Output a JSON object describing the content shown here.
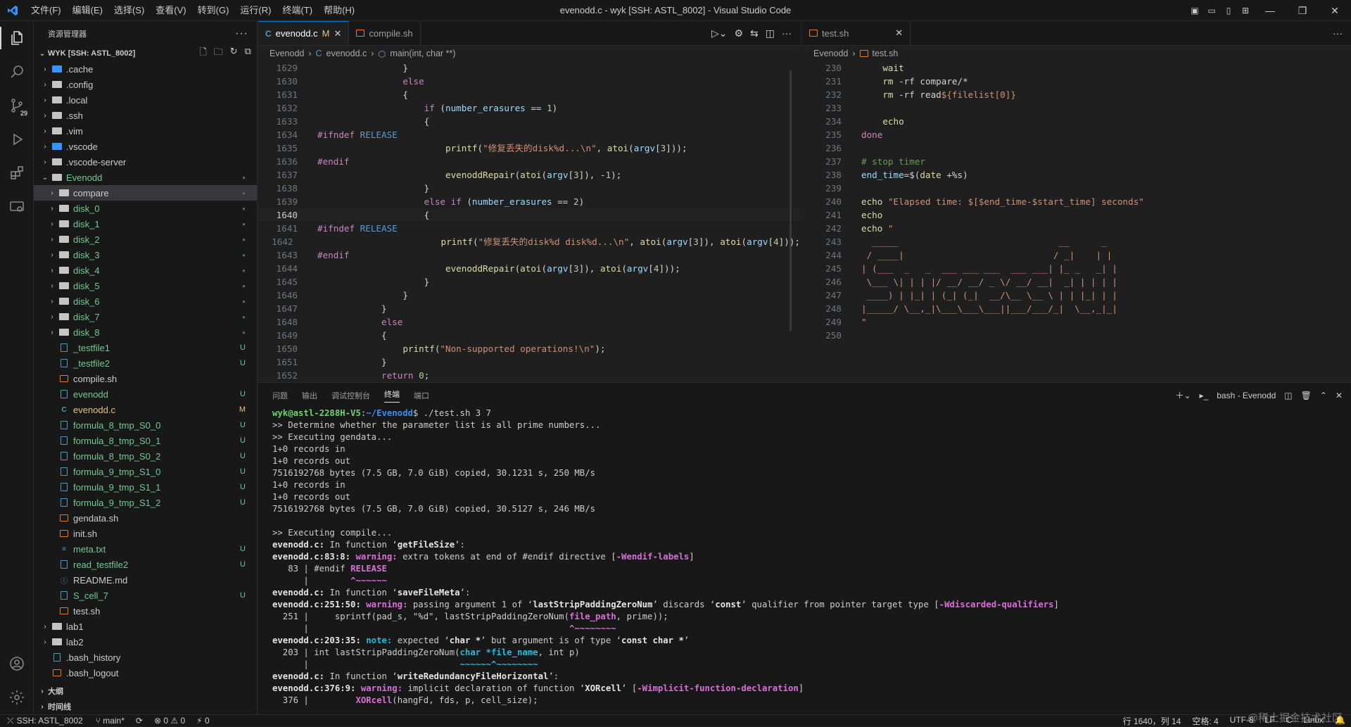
{
  "window": {
    "title": "evenodd.c - wyk [SSH: ASTL_8002] - Visual Studio Code",
    "menu": [
      "文件(F)",
      "编辑(E)",
      "选择(S)",
      "查看(V)",
      "转到(G)",
      "运行(R)",
      "终端(T)",
      "帮助(H)"
    ]
  },
  "activity": {
    "scm_badge": "29"
  },
  "sidebar": {
    "title": "资源管理器",
    "workspace": "WYK [SSH: ASTL_8002]",
    "tree": [
      {
        "label": ".cache",
        "kind": "folder-vscode",
        "depth": 0,
        "expanded": false,
        "status": ""
      },
      {
        "label": ".config",
        "kind": "folder",
        "depth": 0,
        "expanded": false,
        "status": ""
      },
      {
        "label": ".local",
        "kind": "folder",
        "depth": 0,
        "expanded": false,
        "status": ""
      },
      {
        "label": ".ssh",
        "kind": "folder",
        "depth": 0,
        "expanded": false,
        "status": ""
      },
      {
        "label": ".vim",
        "kind": "folder",
        "depth": 0,
        "expanded": false,
        "status": ""
      },
      {
        "label": ".vscode",
        "kind": "folder-vscode",
        "depth": 0,
        "expanded": false,
        "status": ""
      },
      {
        "label": ".vscode-server",
        "kind": "folder",
        "depth": 0,
        "expanded": false,
        "status": ""
      },
      {
        "label": "Evenodd",
        "kind": "folder",
        "depth": 0,
        "expanded": true,
        "status": "dot-green"
      },
      {
        "label": "compare",
        "kind": "folder",
        "depth": 1,
        "expanded": false,
        "status": "dot-grey",
        "selected": true
      },
      {
        "label": "disk_0",
        "kind": "folder",
        "depth": 1,
        "expanded": false,
        "status": "dot-green"
      },
      {
        "label": "disk_1",
        "kind": "folder",
        "depth": 1,
        "expanded": false,
        "status": "dot-green"
      },
      {
        "label": "disk_2",
        "kind": "folder",
        "depth": 1,
        "expanded": false,
        "status": "dot-green"
      },
      {
        "label": "disk_3",
        "kind": "folder",
        "depth": 1,
        "expanded": false,
        "status": "dot-green"
      },
      {
        "label": "disk_4",
        "kind": "folder",
        "depth": 1,
        "expanded": false,
        "status": "dot-green"
      },
      {
        "label": "disk_5",
        "kind": "folder",
        "depth": 1,
        "expanded": false,
        "status": "dot-green"
      },
      {
        "label": "disk_6",
        "kind": "folder",
        "depth": 1,
        "expanded": false,
        "status": "dot-green"
      },
      {
        "label": "disk_7",
        "kind": "folder",
        "depth": 1,
        "expanded": false,
        "status": "dot-green"
      },
      {
        "label": "disk_8",
        "kind": "folder",
        "depth": 1,
        "expanded": false,
        "status": "dot-green"
      },
      {
        "label": "_testfile1",
        "kind": "file",
        "depth": 1,
        "status": "U"
      },
      {
        "label": "_testfile2",
        "kind": "file",
        "depth": 1,
        "status": "U"
      },
      {
        "label": "compile.sh",
        "kind": "shell",
        "depth": 1,
        "status": ""
      },
      {
        "label": "evenodd",
        "kind": "file",
        "depth": 1,
        "status": "U"
      },
      {
        "label": "evenodd.c",
        "kind": "c",
        "depth": 1,
        "status": "M"
      },
      {
        "label": "formula_8_tmp_S0_0",
        "kind": "file",
        "depth": 1,
        "status": "U"
      },
      {
        "label": "formula_8_tmp_S0_1",
        "kind": "file",
        "depth": 1,
        "status": "U"
      },
      {
        "label": "formula_8_tmp_S0_2",
        "kind": "file",
        "depth": 1,
        "status": "U"
      },
      {
        "label": "formula_9_tmp_S1_0",
        "kind": "file",
        "depth": 1,
        "status": "U"
      },
      {
        "label": "formula_9_tmp_S1_1",
        "kind": "file",
        "depth": 1,
        "status": "U"
      },
      {
        "label": "formula_9_tmp_S1_2",
        "kind": "file",
        "depth": 1,
        "status": "U"
      },
      {
        "label": "gendata.sh",
        "kind": "shell",
        "depth": 1,
        "status": ""
      },
      {
        "label": "init.sh",
        "kind": "shell",
        "depth": 1,
        "status": ""
      },
      {
        "label": "meta.txt",
        "kind": "txt",
        "depth": 1,
        "status": "U"
      },
      {
        "label": "read_testfile2",
        "kind": "file",
        "depth": 1,
        "status": "U"
      },
      {
        "label": "README.md",
        "kind": "info",
        "depth": 1,
        "status": ""
      },
      {
        "label": "S_cell_7",
        "kind": "file",
        "depth": 1,
        "status": "U"
      },
      {
        "label": "test.sh",
        "kind": "shell",
        "depth": 1,
        "status": ""
      },
      {
        "label": "lab1",
        "kind": "folder",
        "depth": 0,
        "expanded": false,
        "status": ""
      },
      {
        "label": "lab2",
        "kind": "folder",
        "depth": 0,
        "expanded": false,
        "status": ""
      },
      {
        "label": ".bash_history",
        "kind": "file",
        "depth": 0,
        "status": ""
      },
      {
        "label": ".bash_logout",
        "kind": "shell",
        "depth": 0,
        "status": ""
      }
    ],
    "outline_label": "大纲",
    "timeline_label": "时间线"
  },
  "editor1": {
    "tabs": [
      {
        "label": "evenodd.c",
        "modified": "M",
        "active": true,
        "icon": "C"
      },
      {
        "label": "compile.sh",
        "modified": "",
        "active": false,
        "icon": "shell"
      }
    ],
    "breadcrumb": [
      "Evenodd",
      "evenodd.c",
      "main(int, char **)"
    ],
    "current_line": "1640",
    "lines": [
      {
        "no": "1629",
        "html": "                }"
      },
      {
        "no": "1630",
        "html": "                <span class=\"kw\">else</span>"
      },
      {
        "no": "1631",
        "html": "                {"
      },
      {
        "no": "1632",
        "html": "                    <span class=\"kw\">if</span> (<span class=\"var\">number_erasures</span> == <span class=\"num\">1</span>)"
      },
      {
        "no": "1633",
        "html": "                    {"
      },
      {
        "no": "1634",
        "html": "<span class=\"pp\">#ifndef</span> <span class=\"mac\">RELEASE</span>"
      },
      {
        "no": "1635",
        "html": "                        <span class=\"fn\">printf</span>(<span class=\"str\">\"修复丢失的disk%d...\\n\"</span>, <span class=\"fn\">atoi</span>(<span class=\"var\">argv</span>[<span class=\"num\">3</span>]));"
      },
      {
        "no": "1636",
        "html": "<span class=\"pp\">#endif</span>"
      },
      {
        "no": "1637",
        "html": "                        <span class=\"fn\">evenoddRepair</span>(<span class=\"fn\">atoi</span>(<span class=\"var\">argv</span>[<span class=\"num\">3</span>]), -<span class=\"num\">1</span>);"
      },
      {
        "no": "1638",
        "html": "                    }"
      },
      {
        "no": "1639",
        "html": "                    <span class=\"kw\">else if</span> (<span class=\"var\">number_erasures</span> == <span class=\"num\">2</span>)"
      },
      {
        "no": "1640",
        "html": "                    {"
      },
      {
        "no": "1641",
        "html": "<span class=\"pp\">#ifndef</span> <span class=\"mac\">RELEASE</span>"
      },
      {
        "no": "1642",
        "html": "                        <span class=\"fn\">printf</span>(<span class=\"str\">\"修复丢失的disk%d disk%d...\\n\"</span>, <span class=\"fn\">atoi</span>(<span class=\"var\">argv</span>[<span class=\"num\">3</span>]), <span class=\"fn\">atoi</span>(<span class=\"var\">argv</span>[<span class=\"num\">4</span>]));"
      },
      {
        "no": "1643",
        "html": "<span class=\"pp\">#endif</span>"
      },
      {
        "no": "1644",
        "html": "                        <span class=\"fn\">evenoddRepair</span>(<span class=\"fn\">atoi</span>(<span class=\"var\">argv</span>[<span class=\"num\">3</span>]), <span class=\"fn\">atoi</span>(<span class=\"var\">argv</span>[<span class=\"num\">4</span>]));"
      },
      {
        "no": "1645",
        "html": "                    }"
      },
      {
        "no": "1646",
        "html": "                }"
      },
      {
        "no": "1647",
        "html": "            }"
      },
      {
        "no": "1648",
        "html": "            <span class=\"kw\">else</span>"
      },
      {
        "no": "1649",
        "html": "            {"
      },
      {
        "no": "1650",
        "html": "                <span class=\"fn\">printf</span>(<span class=\"str\">\"Non-supported operations!\\n\"</span>);"
      },
      {
        "no": "1651",
        "html": "            }"
      },
      {
        "no": "1652",
        "html": "            <span class=\"kw\">return</span> <span class=\"num\">0</span>;"
      }
    ]
  },
  "editor2": {
    "tabs": [
      {
        "label": "test.sh",
        "active": false,
        "icon": "shell"
      }
    ],
    "breadcrumb": [
      "Evenodd",
      "test.sh"
    ],
    "lines": [
      {
        "no": "230",
        "html": "    <span class=\"fn\">wait</span>"
      },
      {
        "no": "231",
        "html": "    <span class=\"fn\">rm</span> -rf compare/*"
      },
      {
        "no": "232",
        "html": "    <span class=\"fn\">rm</span> -rf read<span class=\"str\">${filelist[0]}</span>"
      },
      {
        "no": "233",
        "html": ""
      },
      {
        "no": "234",
        "html": "    <span class=\"fn\">echo</span>"
      },
      {
        "no": "235",
        "html": "<span class=\"kw\">done</span>"
      },
      {
        "no": "236",
        "html": ""
      },
      {
        "no": "237",
        "html": "<span class=\"cm\"># stop timer</span>"
      },
      {
        "no": "238",
        "html": "<span class=\"var\">end_time</span>=$(<span class=\"fn\">date</span> +%s)"
      },
      {
        "no": "239",
        "html": ""
      },
      {
        "no": "240",
        "html": "<span class=\"fn\">echo</span> <span class=\"str\">\"Elapsed time: $[$end_time-$start_time] seconds\"</span>"
      },
      {
        "no": "241",
        "html": "<span class=\"fn\">echo</span>"
      },
      {
        "no": "242",
        "html": "<span class=\"fn\">echo</span> <span class=\"str\">\"</span>"
      },
      {
        "no": "243",
        "html": "<span class=\"str\">  _____                              __      _ </span>"
      },
      {
        "no": "244",
        "html": "<span class=\"str\"> / ____|                            / _|    | |</span>"
      },
      {
        "no": "245",
        "html": "<span class=\"str\">| (___  _   _  ___ ___ ___  ___ ___| |_ _   _| |</span>"
      },
      {
        "no": "246",
        "html": "<span class=\"str\"> \\___ \\| | | |/ __/ __/ _ \\/ __/ __|  _| | | | |</span>"
      },
      {
        "no": "247",
        "html": "<span class=\"str\"> ____) | |_| | (_| (_|  __/\\__ \\__ \\ | | |_| | |</span>"
      },
      {
        "no": "248",
        "html": "<span class=\"str\">|_____/ \\__,_|\\___\\___\\___||___/___/_|  \\__,_|_|</span>"
      },
      {
        "no": "249",
        "html": "<span class=\"str\">\"</span>"
      },
      {
        "no": "250",
        "html": ""
      }
    ]
  },
  "panel": {
    "tabs": [
      "问题",
      "输出",
      "调试控制台",
      "终端",
      "端口"
    ],
    "active_tab": "终端",
    "terminal_name": "bash - Evenodd",
    "terminal_lines": [
      "<span class=\"tgreen\">wyk@astl-2288H-V5</span>:<span class=\"tblue\">~/Evenodd</span>$ ./test.sh 3 7",
      ">> Determine whether the parameter list is all prime numbers...",
      ">> Executing gendata...",
      "1+0 records in",
      "1+0 records out",
      "7516192768 bytes (7.5 GB, 7.0 GiB) copied, 30.1231 s, 250 MB/s",
      "1+0 records in",
      "1+0 records out",
      "7516192768 bytes (7.5 GB, 7.0 GiB) copied, 30.5127 s, 246 MB/s",
      "",
      ">> Executing compile...",
      "<span class=\"twhite\">evenodd.c:</span> In function ‘<span class=\"twhite\">getFileSize</span>’:",
      "<span class=\"twhite\">evenodd.c:83:8:</span> <span class=\"tmag\">warning: </span>extra tokens at end of #endif directive [<span class=\"tmag\">-Wendif-labels</span>]",
      "   83 | #endif <span class=\"tmag\">RELEASE</span>",
      "      |        <span class=\"tmag\">^~~~~~~</span>",
      "<span class=\"twhite\">evenodd.c:</span> In function ‘<span class=\"twhite\">saveFileMeta</span>’:",
      "<span class=\"twhite\">evenodd.c:251:50:</span> <span class=\"tmag\">warning: </span>passing argument 1 of ‘<span class=\"twhite\">lastStripPaddingZeroNum</span>’ discards ‘<span class=\"twhite\">const</span>’ qualifier from pointer target type [<span class=\"tmag\">-Wdiscarded-qualifiers</span>]",
      "  251 |     sprintf(pad_s, \"%d\", lastStripPaddingZeroNum(<span class=\"tmag\">file_path</span>, prime));",
      "      |                                                  <span class=\"tmag\">^~~~~~~~~</span>",
      "<span class=\"twhite\">evenodd.c:203:35:</span> <span class=\"tcyan\">note: </span>expected ‘<span class=\"twhite\">char *</span>’ but argument is of type ‘<span class=\"twhite\">const char *</span>’",
      "  203 | int lastStripPaddingZeroNum(<span class=\"tcyan\">char *file_name</span>, int p)",
      "      |                             <span class=\"tcyan\">~~~~~~^~~~~~~~~</span>",
      "<span class=\"twhite\">evenodd.c:</span> In function ‘<span class=\"twhite\">writeRedundancyFileHorizontal</span>’:",
      "<span class=\"twhite\">evenodd.c:376:9:</span> <span class=\"tmag\">warning: </span>implicit declaration of function ‘<span class=\"twhite\">XORcell</span>’ [<span class=\"tmag\">-Wimplicit-function-declaration</span>]",
      "  376 |         <span class=\"tmag\">XORcell</span>(hangFd, fds, p, cell_size);"
    ]
  },
  "status": {
    "remote": "SSH: ASTL_8002",
    "branch": "main*",
    "errors": "0",
    "warnings": "0",
    "ports": "0",
    "position": "行 1640，列 14",
    "spaces": "空格: 4",
    "encoding": "UTF-8",
    "eol": "LF",
    "lang": "C",
    "platform": "Linux"
  },
  "watermark": "@稀土掘金技术社区"
}
